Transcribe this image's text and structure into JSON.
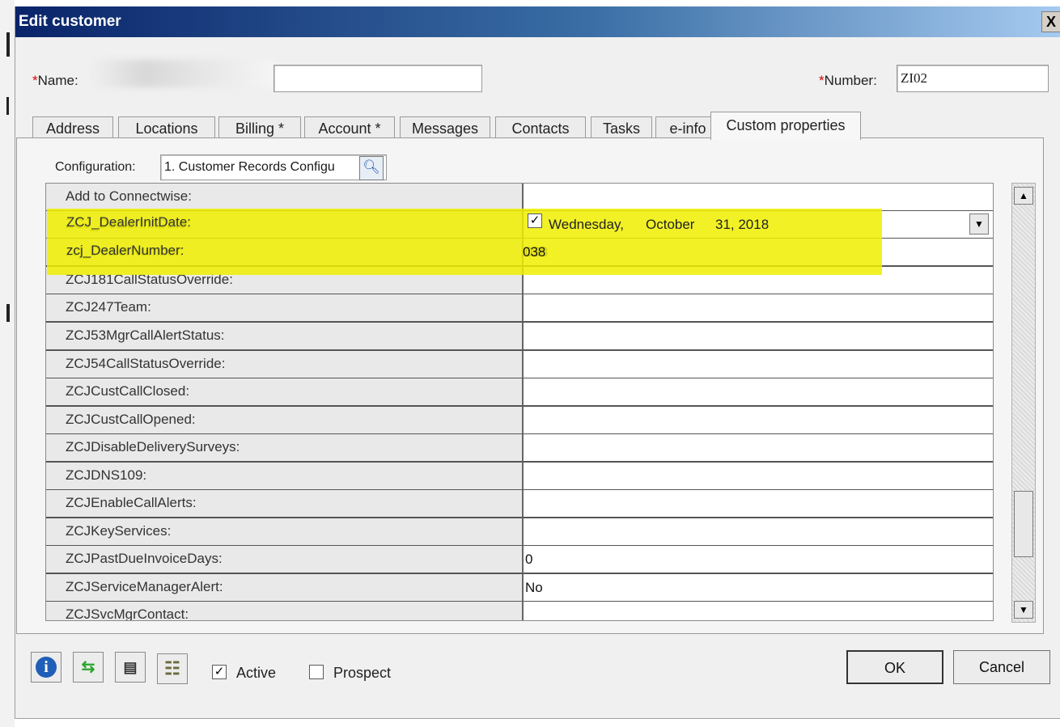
{
  "window": {
    "title": "Edit customer",
    "close_label": "X"
  },
  "header": {
    "name_required_mark": "*",
    "name_label": "Name:",
    "number_required_mark": "*",
    "number_label": "Number:",
    "number_value": "ZI02"
  },
  "tabs": [
    {
      "label": "Address"
    },
    {
      "label": "Locations"
    },
    {
      "label": "Billing *"
    },
    {
      "label": "Account *"
    },
    {
      "label": "Messages"
    },
    {
      "label": "Contacts"
    },
    {
      "label": "Tasks"
    },
    {
      "label": "e-info"
    },
    {
      "label": "Custom properties",
      "active": true
    }
  ],
  "config": {
    "label": "Configuration:",
    "value": "1. Customer Records Configu"
  },
  "date_field": {
    "checked": true,
    "day": "Wednesday,",
    "month": "October",
    "date": "31, 2018"
  },
  "properties": [
    {
      "key": "Add to Connectwise:",
      "value": ""
    },
    {
      "key": "ZCJ_DealerInitDate:",
      "value": ""
    },
    {
      "key": "zcj_DealerNumber:",
      "value": "038"
    },
    {
      "key": "ZCJ181CallStatusOverride:",
      "value": ""
    },
    {
      "key": "ZCJ247Team:",
      "value": ""
    },
    {
      "key": "ZCJ53MgrCallAlertStatus:",
      "value": ""
    },
    {
      "key": "ZCJ54CallStatusOverride:",
      "value": ""
    },
    {
      "key": "ZCJCustCallClosed:",
      "value": ""
    },
    {
      "key": "ZCJCustCallOpened:",
      "value": ""
    },
    {
      "key": "ZCJDisableDeliverySurveys:",
      "value": ""
    },
    {
      "key": "ZCJDNS109:",
      "value": ""
    },
    {
      "key": "ZCJEnableCallAlerts:",
      "value": ""
    },
    {
      "key": "ZCJKeyServices:",
      "value": ""
    },
    {
      "key": "ZCJPastDueInvoiceDays:",
      "value": "0"
    },
    {
      "key": "ZCJServiceManagerAlert:",
      "value": "No"
    },
    {
      "key": "ZCJSvcMgrContact:",
      "value": ""
    }
  ],
  "footer": {
    "active_label": "Active",
    "active_checked": true,
    "prospect_label": "Prospect",
    "prospect_checked": false,
    "ok_label": "OK",
    "cancel_label": "Cancel"
  },
  "icons": [
    "info-icon",
    "transfer-icon",
    "document-icon",
    "notes-icon",
    "search-icon",
    "dropdown-arrow-icon",
    "scroll-up-icon",
    "scroll-down-icon"
  ],
  "colors": {
    "highlight": "#eeee00",
    "title_start": "#0a246a",
    "title_end": "#a6caf0"
  }
}
